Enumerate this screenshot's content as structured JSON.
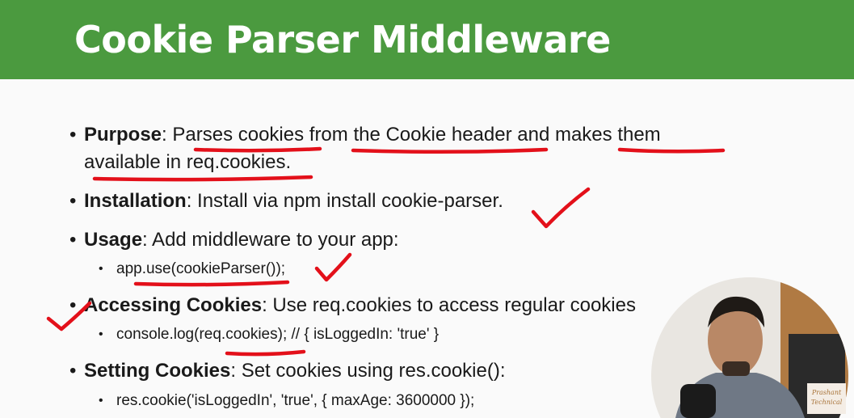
{
  "slide": {
    "title": "Cookie Parser Middleware",
    "bullets": [
      {
        "label": "Purpose",
        "line1": ": Parses cookies from the Cookie header and makes them",
        "line2": "available in req.cookies."
      },
      {
        "label": "Installation",
        "text": ": Install via npm install cookie-parser."
      },
      {
        "label": "Usage",
        "text": ": Add middleware to your app:",
        "sub": "app.use(cookieParser());"
      },
      {
        "label": "Accessing Cookies",
        "text": ": Use req.cookies to access regular cookies",
        "sub": "console.log(req.cookies);   // { isLoggedIn: 'true' }"
      },
      {
        "label": "Setting Cookies",
        "text": ": Set cookies using res.cookie():",
        "sub": "res.cookie('isLoggedIn', 'true', { maxAge: 3600000 });"
      }
    ]
  },
  "webcam": {
    "watermark_line1": "Prashant",
    "watermark_line2": "Technical"
  },
  "colors": {
    "header": "#4b9a3f",
    "annotation_red": "#e3101a"
  }
}
